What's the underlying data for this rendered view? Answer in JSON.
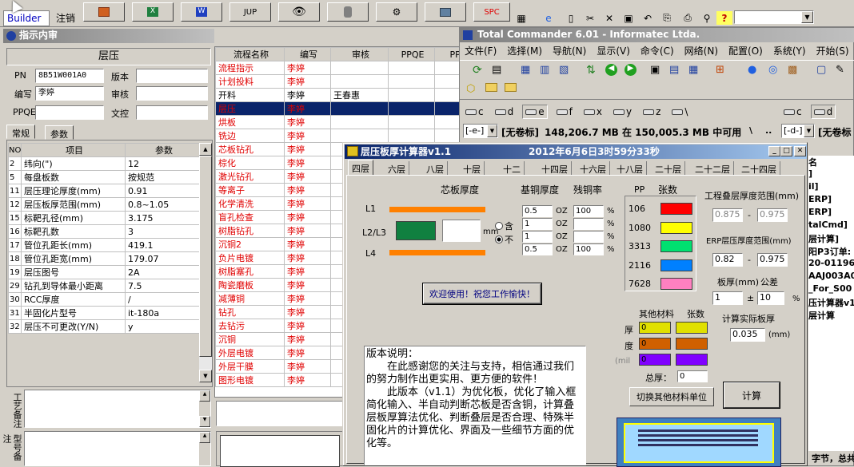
{
  "toolbar": {
    "builder": "Builder",
    "logout": "注销",
    "jup": "JUP",
    "spc": "SPC"
  },
  "left_panel": {
    "title": "指示内审",
    "section": "层压",
    "pn_label": "PN",
    "pn_value": "8B51W001A0",
    "version_label": "版本",
    "author_label": "编写",
    "author_value": "李婷",
    "review_label": "审核",
    "ppqe_label": "PPQE",
    "file_label": "文控",
    "tab_general": "常规",
    "tab_params": "参数",
    "grid_headers": [
      "NO",
      "项目",
      "参数"
    ],
    "grid_rows": [
      [
        "2",
        "纬向(\")",
        "12"
      ],
      [
        "5",
        "每盘板数",
        "按规范"
      ],
      [
        "11",
        "层压理论厚度(mm)",
        "0.91"
      ],
      [
        "12",
        "层压板厚范围(mm)",
        "0.8~1.05"
      ],
      [
        "15",
        "标靶孔径(mm)",
        "3.175"
      ],
      [
        "16",
        "标靶孔数",
        "3"
      ],
      [
        "17",
        "管位孔距长(mm)",
        "419.1"
      ],
      [
        "18",
        "管位孔距宽(mm)",
        "179.07"
      ],
      [
        "19",
        "层压图号",
        "2A"
      ],
      [
        "29",
        "钻孔到导体最小距离",
        "7.5"
      ],
      [
        "30",
        "RCC厚度",
        "/"
      ],
      [
        "31",
        "半固化片型号",
        "it-180a"
      ],
      [
        "32",
        "层压不可更改(Y/N)",
        "y"
      ]
    ],
    "note1": "工艺备注",
    "note2": "型号备注"
  },
  "flow_grid": {
    "headers": [
      "流程名称",
      "编写",
      "审核",
      "PPQE",
      "PPC"
    ],
    "rows": [
      [
        "流程指示",
        "李婷",
        ""
      ],
      [
        "计划投料",
        "李婷",
        ""
      ],
      [
        "开料",
        "李婷",
        "王春惠"
      ],
      [
        "层压",
        "李婷",
        ""
      ],
      [
        "烘板",
        "李婷",
        ""
      ],
      [
        "铣边",
        "李婷",
        ""
      ],
      [
        "芯板钻孔",
        "李婷",
        ""
      ],
      [
        "棕化",
        "李婷",
        ""
      ],
      [
        "激光钻孔",
        "李婷",
        ""
      ],
      [
        "等离子",
        "李婷",
        ""
      ],
      [
        "化学清洗",
        "李婷",
        ""
      ],
      [
        "盲孔检查",
        "李婷",
        ""
      ],
      [
        "树脂钻孔",
        "李婷",
        ""
      ],
      [
        "沉铜2",
        "李婷",
        ""
      ],
      [
        "负片电镀",
        "李婷",
        ""
      ],
      [
        "树脂塞孔",
        "李婷",
        ""
      ],
      [
        "陶瓷磨板",
        "李婷",
        ""
      ],
      [
        "减薄铜",
        "李婷",
        ""
      ],
      [
        "钻孔",
        "李婷",
        ""
      ],
      [
        "去钻污",
        "李婷",
        ""
      ],
      [
        "沉铜",
        "李婷",
        ""
      ],
      [
        "外层电镀",
        "李婷",
        ""
      ],
      [
        "外层干膜",
        "李婷",
        ""
      ],
      [
        "图形电镀",
        "李婷",
        ""
      ]
    ]
  },
  "tc": {
    "title": "Total Commander 6.01 - Informatec Ltda.",
    "menu": [
      "文件(F)",
      "选择(M)",
      "导航(N)",
      "显示(V)",
      "命令(C)",
      "网络(N)",
      "配置(O)",
      "系统(Y)",
      "开始(S)"
    ],
    "drives_left": [
      "c",
      "d",
      "e",
      "f",
      "x",
      "y",
      "z",
      "\\"
    ],
    "drives_right": [
      "c",
      "d"
    ],
    "drive_sel_left": "[-e-]",
    "vol_label_left": "[无卷标]",
    "space_info": "148,206.7 MB 在 150,005.3 MB 中可用",
    "path_sep": "\\",
    "dotdot": "..",
    "drive_sel_right": "[-d-]",
    "vol_label_right": "[无卷标",
    "right_list": [
      "名",
      "]",
      "il]",
      "ERP]",
      "ERP]",
      "talCmd]",
      "层计算]",
      "阳P3订单:",
      "20-01196-0",
      "AAJ003A0:",
      "_For_S00",
      "压计算器v1",
      "层计算"
    ],
    "status": "字节，总共"
  },
  "calc": {
    "title": "层压板厚计算器v1.1",
    "datetime": "2012年6月6日3时59分33秒",
    "tabs": [
      "四层",
      "六层",
      "八层",
      "十层",
      "十二",
      "十四层",
      "十六层",
      "十八层",
      "二十层",
      "二十二层",
      "二十四层"
    ],
    "core_thickness": "芯板厚度",
    "base_copper": "基铜厚度",
    "residual_copper": "残铜率",
    "pp_label": "PP",
    "sheets_label": "张数",
    "l1": "L1",
    "l23": "L2/L3",
    "l4": "L4",
    "mm": "mm",
    "with": "含",
    "without": "不",
    "cu_rows": [
      {
        "base": "0.5",
        "unit": "OZ",
        "res": "100",
        "pct": "%"
      },
      {
        "base": "1",
        "unit": "OZ",
        "res": "",
        "pct": "%"
      },
      {
        "base": "1",
        "unit": "OZ",
        "res": "",
        "pct": "%"
      },
      {
        "base": "0.5",
        "unit": "OZ",
        "res": "100",
        "pct": "%"
      }
    ],
    "pp_items": [
      {
        "name": "106",
        "color": "#ff0000"
      },
      {
        "name": "1080",
        "color": "#ffff00"
      },
      {
        "name": "3313",
        "color": "#00e070"
      },
      {
        "name": "2116",
        "color": "#0080ff"
      },
      {
        "name": "7628",
        "color": "#ff80c0"
      }
    ],
    "welcome": "欢迎使用！祝您工作愉快！",
    "eng_range_label": "工程叠层厚度范围(mm)",
    "eng_min": "0.875",
    "eng_max": "0.975",
    "dash": "-",
    "erp_range_label": "ERP层压厚度范围(mm)",
    "erp_min": "0.82",
    "erp_max": "0.975",
    "board_label": "板厚(mm)",
    "tol_label": "公差",
    "board_value": "1",
    "pm": "±",
    "tol_value": "10",
    "pct": "%",
    "other_label": "其他材料",
    "other_count": "张数",
    "thick_label1": "厚",
    "thick_label2": "度",
    "mil": "(mil",
    "other_rows": [
      {
        "v": "0",
        "c": "#e0e000"
      },
      {
        "v": "0",
        "c": "#d06000"
      },
      {
        "v": "0",
        "c": "#8000ff"
      }
    ],
    "total_label": "总厚：",
    "total_value": "0",
    "actual_label": "计算实际板厚",
    "actual_value": "0.035",
    "actual_unit": "(mm)",
    "switch_button": "切换其他材料单位",
    "calc_button": "计算",
    "version_text": [
      "版本说明：",
      "　　在此感谢您的关注与支持，相信通过我们的努力制作出更实用、更方便的软件！",
      "　　此版本（v1.1）为优化板，优化了输入框简化输入、半自动判断芯板是否含铜，计算叠层板厚算法优化、判断叠层是否合理、特殊半固化片的计算优化、界面及一些细节方面的优化等。"
    ]
  },
  "colors": {
    "accent": "#0a246a",
    "red": "#e00000",
    "core_green": "#108040",
    "copper_orange": "#ff8000"
  }
}
